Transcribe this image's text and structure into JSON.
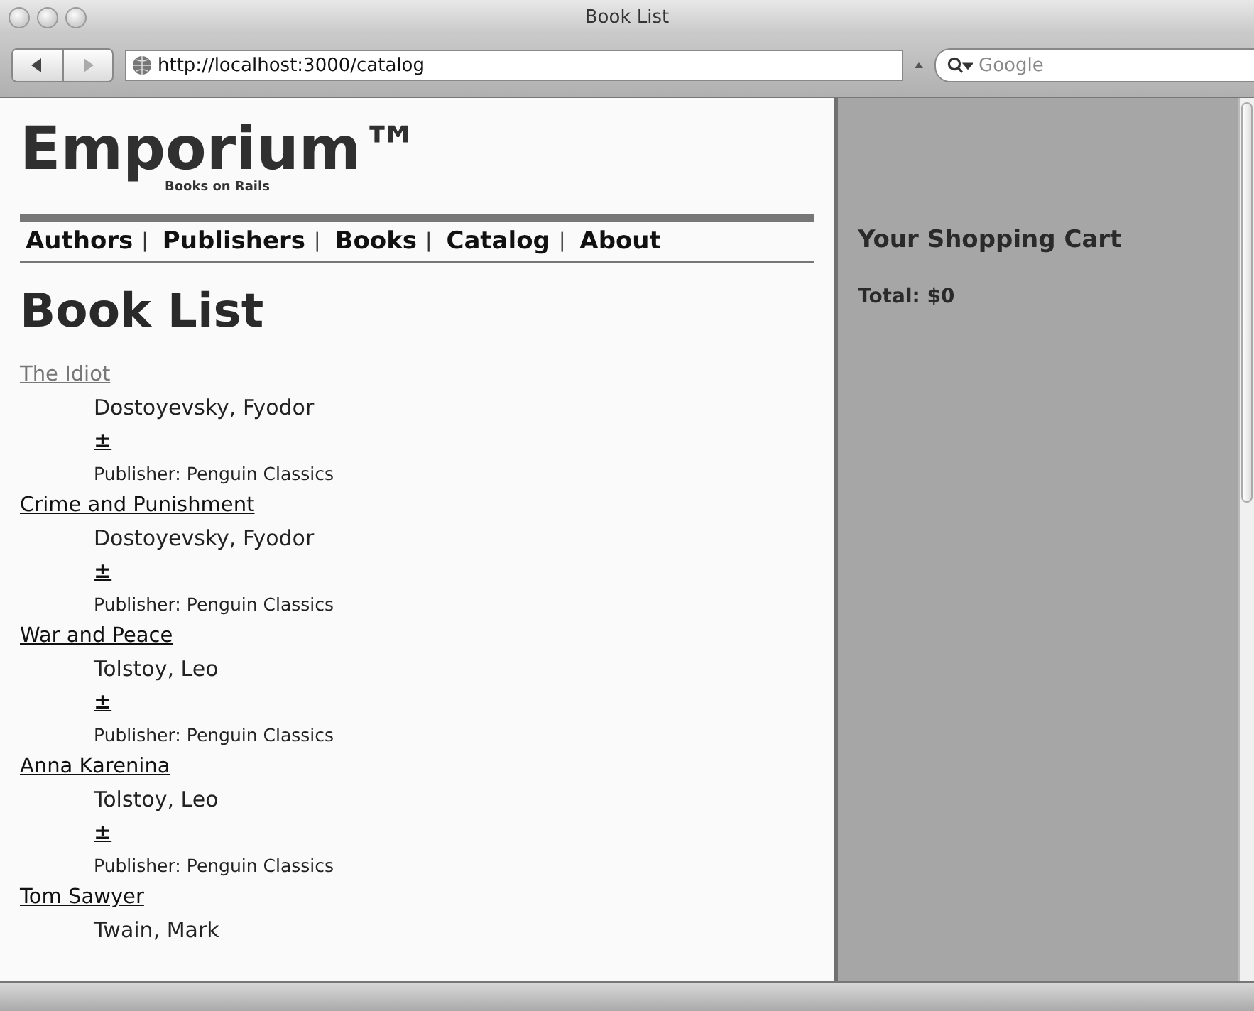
{
  "window": {
    "title": "Book List"
  },
  "toolbar": {
    "url": "http://localhost:3000/catalog",
    "search_placeholder": "Google"
  },
  "site": {
    "logo": "Emporium™",
    "tagline": "Books on Rails"
  },
  "nav": [
    {
      "label": "Authors",
      "separator": "|"
    },
    {
      "label": "Publishers",
      "separator": "|"
    },
    {
      "label": "Books",
      "separator": "|"
    },
    {
      "label": "Catalog",
      "separator": "|"
    },
    {
      "label": "About"
    }
  ],
  "heading": "Book List",
  "books": [
    {
      "title": "The Idiot",
      "visited": true,
      "author": "Dostoyevsky, Fyodor",
      "add": "±",
      "publisher": "Publisher: Penguin Classics"
    },
    {
      "title": "Crime and Punishment",
      "visited": false,
      "author": "Dostoyevsky, Fyodor",
      "add": "±",
      "publisher": "Publisher: Penguin Classics"
    },
    {
      "title": "War and Peace",
      "visited": false,
      "author": "Tolstoy, Leo",
      "add": "±",
      "publisher": "Publisher: Penguin Classics"
    },
    {
      "title": "Anna Karenina",
      "visited": false,
      "author": "Tolstoy, Leo",
      "add": "±",
      "publisher": "Publisher: Penguin Classics"
    },
    {
      "title": "Tom Sawyer",
      "visited": false,
      "author": "Twain, Mark"
    }
  ],
  "cart": {
    "title": "Your Shopping Cart",
    "total": "Total: $0"
  }
}
